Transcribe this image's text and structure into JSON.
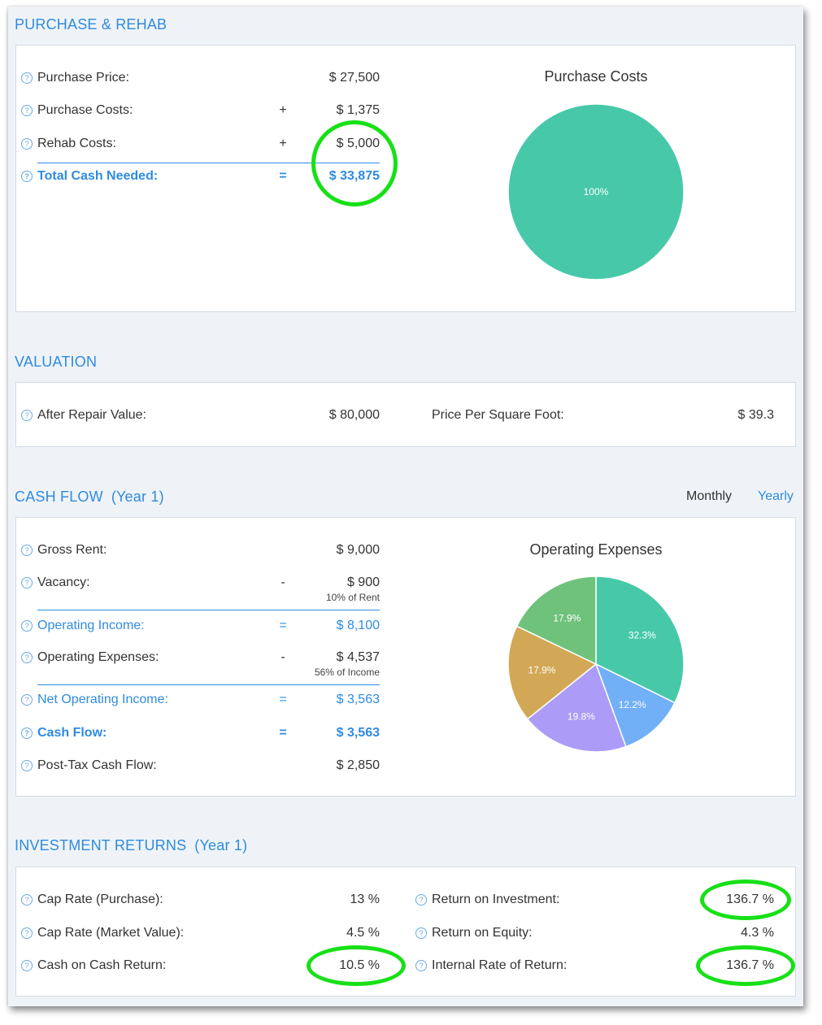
{
  "purchase": {
    "title": "PURCHASE & REHAB",
    "rows": [
      {
        "label": "Purchase Price:",
        "op": "",
        "value": "$ 27,500"
      },
      {
        "label": "Purchase Costs:",
        "op": "+",
        "value": "$ 1,375"
      },
      {
        "label": "Rehab Costs:",
        "op": "+",
        "value": "$ 5,000"
      },
      {
        "label": "Total Cash Needed:",
        "op": "=",
        "value": "$ 33,875"
      }
    ],
    "chart_title": "Purchase Costs"
  },
  "valuation": {
    "title": "VALUATION",
    "arv_label": "After Repair Value:",
    "arv_value": "$ 80,000",
    "ppsf_label": "Price Per Square Foot:",
    "ppsf_value": "$ 39.3"
  },
  "cashflow": {
    "title": "CASH FLOW",
    "subtitle": "(Year 1)",
    "toggle_monthly": "Monthly",
    "toggle_yearly": "Yearly",
    "rows": [
      {
        "label": "Gross Rent:",
        "op": "",
        "value": "$ 9,000",
        "note": ""
      },
      {
        "label": "Vacancy:",
        "op": "-",
        "value": "$ 900",
        "note": "10% of Rent"
      },
      {
        "label": "Operating Income:",
        "op": "=",
        "value": "$ 8,100",
        "note": ""
      },
      {
        "label": "Operating Expenses:",
        "op": "-",
        "value": "$ 4,537",
        "note": "56% of Income"
      },
      {
        "label": "Net Operating Income:",
        "op": "=",
        "value": "$ 3,563",
        "note": ""
      },
      {
        "label": "Cash Flow:",
        "op": "=",
        "value": "$ 3,563",
        "note": ""
      },
      {
        "label": "Post-Tax Cash Flow:",
        "op": "",
        "value": "$ 2,850",
        "note": ""
      }
    ],
    "chart_title": "Operating Expenses"
  },
  "returns": {
    "title": "INVESTMENT RETURNS",
    "subtitle": "(Year 1)",
    "left": [
      {
        "label": "Cap Rate (Purchase):",
        "value": "13 %"
      },
      {
        "label": "Cap Rate (Market Value):",
        "value": "4.5 %"
      },
      {
        "label": "Cash on Cash Return:",
        "value": "10.5 %"
      }
    ],
    "right": [
      {
        "label": "Return on Investment:",
        "value": "136.7 %"
      },
      {
        "label": "Return on Equity:",
        "value": "4.3 %"
      },
      {
        "label": "Internal Rate of Return:",
        "value": "136.7 %"
      }
    ]
  },
  "help_glyph": "?",
  "colors": {
    "accent": "#2f8be0",
    "highlight": "#17e017",
    "slice_teal": "#47c9a9",
    "slice_blue": "#71b0f7",
    "slice_purple": "#ac9cf7",
    "slice_gold": "#d2a856",
    "slice_green": "#6fc27c"
  },
  "chart_data": [
    {
      "type": "pie",
      "title": "Purchase Costs",
      "values": [
        100
      ],
      "labels": [
        "100%"
      ],
      "colors": [
        "#47c9a9"
      ]
    },
    {
      "type": "pie",
      "title": "Operating Expenses",
      "values": [
        32.3,
        12.2,
        19.8,
        17.9,
        17.9
      ],
      "labels": [
        "32.3%",
        "12.2%",
        "19.8%",
        "17.9%",
        "17.9%"
      ],
      "colors": [
        "#47c9a9",
        "#71b0f7",
        "#ac9cf7",
        "#d2a856",
        "#6fc27c"
      ]
    }
  ]
}
